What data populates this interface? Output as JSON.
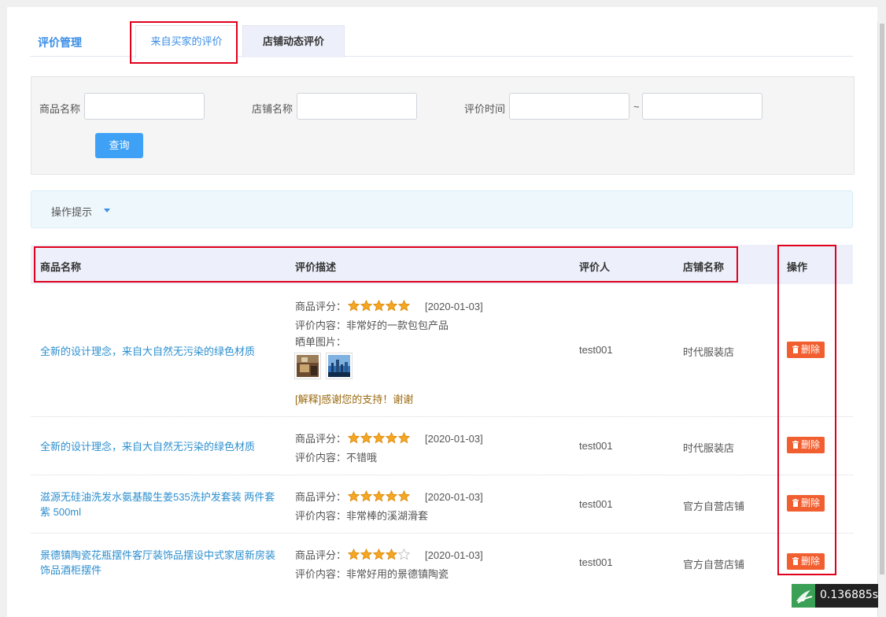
{
  "tabs": {
    "title": "评价管理",
    "active": "来自买家的评价",
    "inactive": "店铺动态评价"
  },
  "search": {
    "goods_label": "商品名称",
    "store_label": "店铺名称",
    "time_label": "评价时间",
    "tilde": "~",
    "query_label": "查询"
  },
  "tips": {
    "label": "操作提示"
  },
  "table": {
    "headers": {
      "goods": "商品名称",
      "desc": "评价描述",
      "reviewer": "评价人",
      "store": "店铺名称",
      "action": "操作"
    },
    "score_label": "商品评分：",
    "content_prefix": "评价内容：",
    "photos_label": "晒单图片：",
    "delete_label": "删除",
    "rows": [
      {
        "goods": "全新的设计理念，来自大自然无污染的绿色材质",
        "rating": 5,
        "date": "[2020-01-03]",
        "content": "非常好的一款包包产品",
        "reply": "[解释]感谢您的支持！谢谢",
        "reviewer": "test001",
        "store": "时代服装店"
      },
      {
        "goods": "全新的设计理念，来自大自然无污染的绿色材质",
        "rating": 5,
        "date": "[2020-01-03]",
        "content": "不错哦",
        "reviewer": "test001",
        "store": "时代服装店"
      },
      {
        "goods_line1": "滋源无硅油洗发水氨基酸生姜535洗护发套装 两件套",
        "goods_line2": "紫 500ml",
        "rating": 5,
        "date": "[2020-01-03]",
        "content": "非常棒的溪湖滑套",
        "reviewer": "test001",
        "store": "官方自营店铺"
      },
      {
        "goods_line1": "景德镇陶瓷花瓶摆件客厅装饰品摆设中式家居新房装",
        "goods_line2": "饰品酒柜摆件",
        "rating": 4,
        "date": "[2020-01-03]",
        "content": "非常好用的景德镇陶瓷",
        "reviewer": "test001",
        "store": "官方自营店铺"
      }
    ]
  },
  "timer": {
    "value": "0.136885s"
  },
  "colors": {
    "accent": "#3a8ee6",
    "delete": "#f15f31",
    "highlight": "#e0001b",
    "star": "#f5a623"
  }
}
